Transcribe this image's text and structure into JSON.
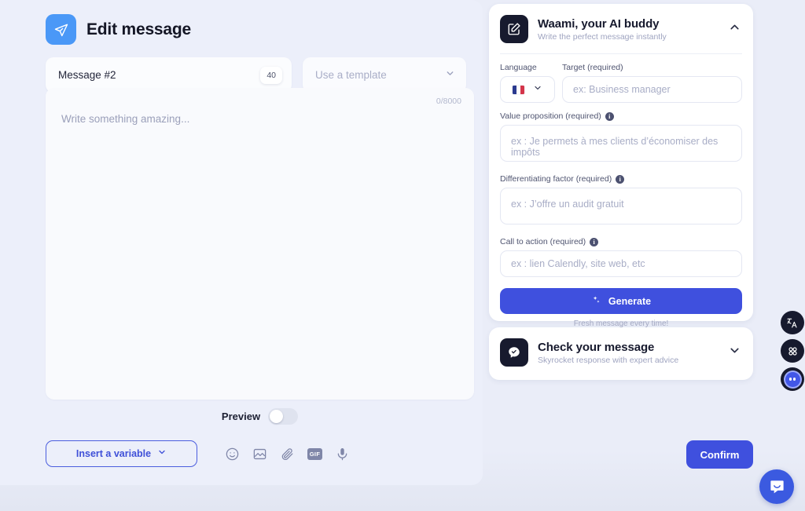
{
  "header": {
    "title": "Edit message",
    "icon": "send-plane-icon"
  },
  "message_field": {
    "value": "Message #2",
    "counter": "40"
  },
  "template_select": {
    "placeholder": "Use a template",
    "chevron": "chevron-down-icon"
  },
  "composer": {
    "placeholder": "Write something amazing...",
    "counter": "0/8000"
  },
  "preview": {
    "label": "Preview",
    "enabled": false
  },
  "toolbar": {
    "insert_variable_label": "Insert a variable",
    "icons": [
      {
        "name": "emoji-icon",
        "label": "Emoji"
      },
      {
        "name": "image-icon",
        "label": "Image"
      },
      {
        "name": "attachment-icon",
        "label": "Attachment"
      },
      {
        "name": "gif-icon",
        "label": "GIF"
      },
      {
        "name": "microphone-icon",
        "label": "Voice note"
      }
    ],
    "confirm_label": "Confirm"
  },
  "waami_panel": {
    "title": "Waami, your AI buddy",
    "subtitle": "Write the perfect message instantly",
    "icon": "edit-square-icon",
    "collapse_icon": "chevron-up-icon",
    "language_label": "Language",
    "language_flag": "france-flag-icon",
    "target_label": "Target (required)",
    "target_placeholder": "ex: Business manager",
    "value_prop_label": "Value proposition (required)",
    "value_prop_placeholder": "ex : Je permets à mes clients d’économiser des impôts",
    "diff_factor_label": "Differentiating factor (required)",
    "diff_factor_placeholder": "ex : J’offre un audit gratuit",
    "cta_label": "Call to action (required)",
    "cta_placeholder": "ex : lien Calendly, site web, etc",
    "generate_label": "Generate",
    "generate_note": "Fresh message every time!",
    "info_char": "i"
  },
  "check_panel": {
    "title": "Check your message",
    "subtitle": "Skyrocket response with expert advice",
    "icon": "chat-check-icon",
    "expand_icon": "chevron-down-icon"
  },
  "rail": [
    {
      "name": "translate-icon"
    },
    {
      "name": "apps-grid-icon"
    },
    {
      "name": "assistant-avatar-icon"
    }
  ],
  "intercom": {
    "name": "intercom-chat-icon"
  },
  "colors": {
    "accent": "#3f50de",
    "send_badge": "#4a98f7",
    "panel_icon": "#171a2e",
    "page_bg": "#eaedf8"
  }
}
